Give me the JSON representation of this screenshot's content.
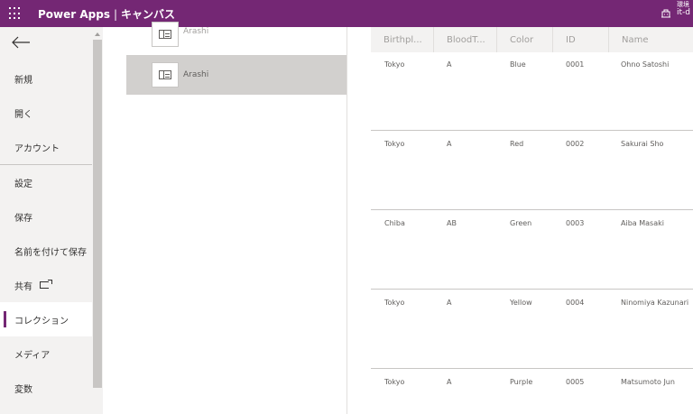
{
  "topbar": {
    "app_name": "Power Apps",
    "separator": "|",
    "page": "キャンバス",
    "env_label": "環境",
    "env_name": "it-d"
  },
  "nav": {
    "back_label": "戻る",
    "items": [
      {
        "label": "新規"
      },
      {
        "label": "開く"
      },
      {
        "label": "アカウント"
      },
      {
        "label": "設定"
      },
      {
        "label": "保存"
      },
      {
        "label": "名前を付けて保存"
      },
      {
        "label": "共有"
      },
      {
        "label": "コレクション",
        "selected": true
      },
      {
        "label": "メディア"
      },
      {
        "label": "変数"
      }
    ]
  },
  "collections": [
    {
      "name": "Arashi"
    },
    {
      "name": "Arashi"
    }
  ],
  "table": {
    "columns": [
      "Birthpl...",
      "BloodT...",
      "Color",
      "ID",
      "Name"
    ],
    "rows": [
      {
        "birthplace": "Tokyo",
        "blood": "A",
        "color": "Blue",
        "id": "0001",
        "name": "Ohno Satoshi"
      },
      {
        "birthplace": "Tokyo",
        "blood": "A",
        "color": "Red",
        "id": "0002",
        "name": "Sakurai Sho"
      },
      {
        "birthplace": "Chiba",
        "blood": "AB",
        "color": "Green",
        "id": "0003",
        "name": "Aiba Masaki"
      },
      {
        "birthplace": "Tokyo",
        "blood": "A",
        "color": "Yellow",
        "id": "0004",
        "name": "Ninomiya Kazunari"
      },
      {
        "birthplace": "Tokyo",
        "blood": "A",
        "color": "Purple",
        "id": "0005",
        "name": "Matsumoto Jun"
      }
    ]
  },
  "colors": {
    "brand": "#742774",
    "nav_bg": "#f3f2f1",
    "selected_collection": "#d2d0ce"
  }
}
